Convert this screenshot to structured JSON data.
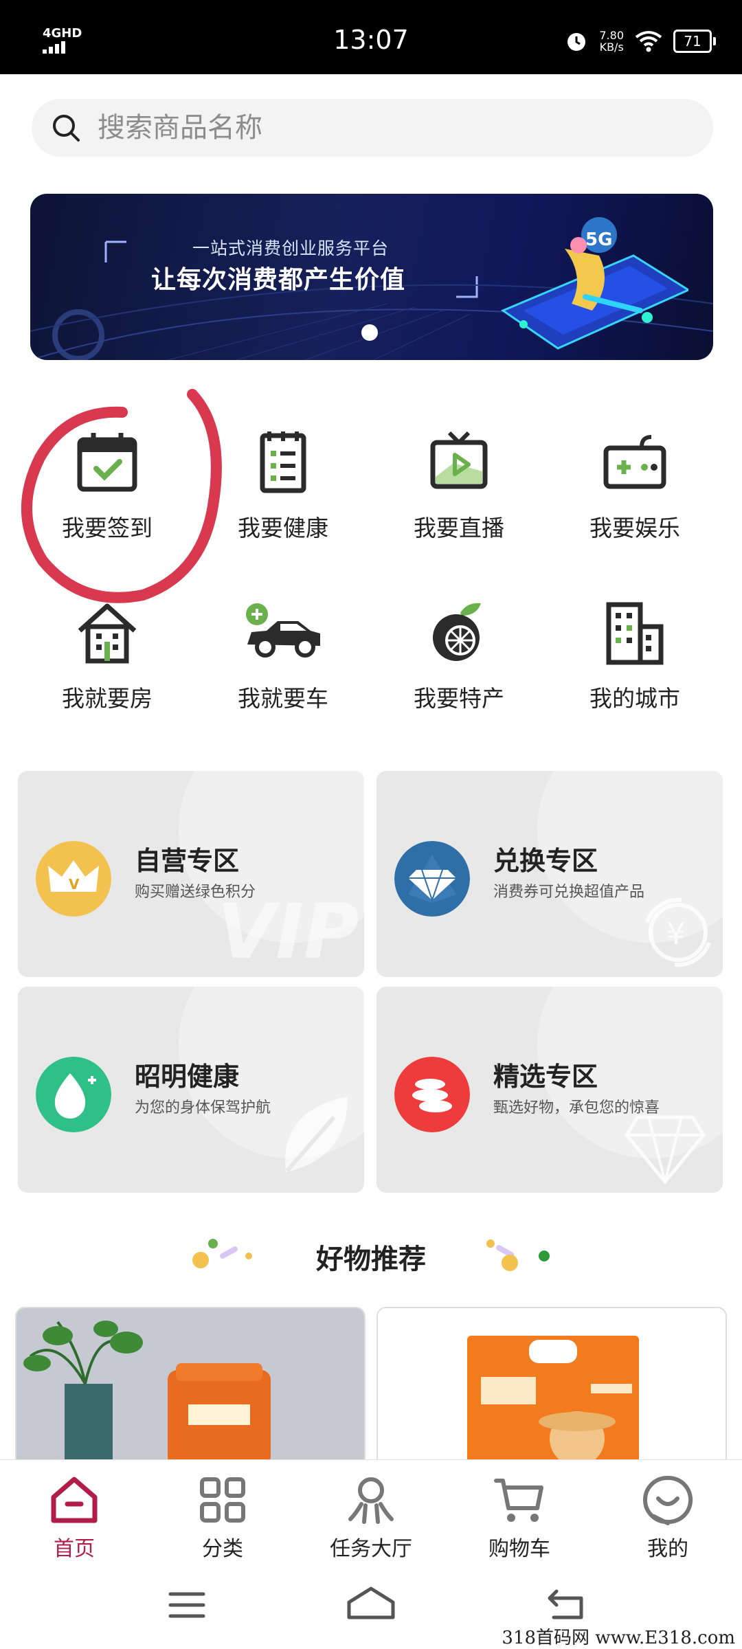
{
  "status_bar": {
    "network": "4GHD",
    "time": "13:07",
    "speed_value": "7.80",
    "speed_unit": "KB/s",
    "battery": "71"
  },
  "search": {
    "placeholder": "搜索商品名称"
  },
  "banner": {
    "subtitle": "一站式消费创业服务平台",
    "title": "让每次消费都产生价值"
  },
  "shortcuts": [
    {
      "label": "我要签到",
      "icon": "calendar-check-icon"
    },
    {
      "label": "我要健康",
      "icon": "checklist-icon"
    },
    {
      "label": "我要直播",
      "icon": "tv-play-icon"
    },
    {
      "label": "我要娱乐",
      "icon": "gamepad-icon"
    },
    {
      "label": "我就要房",
      "icon": "house-icon"
    },
    {
      "label": "我就要车",
      "icon": "car-icon"
    },
    {
      "label": "我要特产",
      "icon": "orange-fruit-icon"
    },
    {
      "label": "我的城市",
      "icon": "city-building-icon"
    }
  ],
  "promo_cards": [
    {
      "title": "自营专区",
      "subtitle": "购买赠送绿色积分",
      "icon": "crown-icon",
      "watermark": "VIP"
    },
    {
      "title": "兑换专区",
      "subtitle": "消费券可兑换超值产品",
      "icon": "diamond-icon",
      "watermark": "¥"
    },
    {
      "title": "昭明健康",
      "subtitle": "为您的身体保驾护航",
      "icon": "water-drop-icon"
    },
    {
      "title": "精选专区",
      "subtitle": "甄选好物，承包您的惊喜",
      "icon": "coins-icon"
    }
  ],
  "recommend": {
    "title": "好物推荐"
  },
  "tabs": [
    {
      "label": "首页",
      "icon": "home-icon",
      "active": true
    },
    {
      "label": "分类",
      "icon": "grid-icon"
    },
    {
      "label": "任务大厅",
      "icon": "task-hall-icon"
    },
    {
      "label": "购物车",
      "icon": "cart-icon"
    },
    {
      "label": "我的",
      "icon": "profile-icon"
    }
  ],
  "colors": {
    "accent": "#b11d48",
    "annotation": "#d8394f"
  },
  "watermark": "318首码网 www.E318.com"
}
